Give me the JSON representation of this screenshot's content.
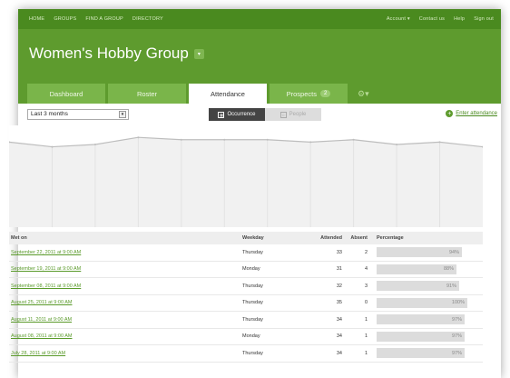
{
  "nav": {
    "left": [
      "HOME",
      "GROUPS",
      "FIND A GROUP",
      "DIRECTORY"
    ],
    "right": [
      "Account ▾",
      "Contact us",
      "Help",
      "Sign out"
    ]
  },
  "group": {
    "title": "Women's Hobby Group"
  },
  "tabs": [
    {
      "label": "Dashboard"
    },
    {
      "label": "Roster"
    },
    {
      "label": "Attendance"
    },
    {
      "label": "Prospects",
      "badge": "2"
    }
  ],
  "controls": {
    "period": "Last 3 months",
    "toggle_occurrence": "Occurrence",
    "toggle_people": "People",
    "enter_attendance": "Enter attendance"
  },
  "chart_data": {
    "type": "area",
    "values": [
      33,
      31,
      32,
      35,
      34,
      34,
      34,
      33,
      34,
      32,
      33,
      31
    ]
  },
  "table": {
    "headers": {
      "met_on": "Met on",
      "weekday": "Weekday",
      "attended": "Attended",
      "absent": "Absent",
      "percentage": "Percentage"
    },
    "rows": [
      {
        "met_on": "September 22, 2011 at 9:00 AM",
        "weekday": "Thursday",
        "attended": "33",
        "absent": "2",
        "percentage": "94%",
        "pct_value": 94
      },
      {
        "met_on": "September 19, 2011 at 9:00 AM",
        "weekday": "Monday",
        "attended": "31",
        "absent": "4",
        "percentage": "88%",
        "pct_value": 88
      },
      {
        "met_on": "September 08, 2011 at 9:00 AM",
        "weekday": "Thursday",
        "attended": "32",
        "absent": "3",
        "percentage": "91%",
        "pct_value": 91
      },
      {
        "met_on": "August 25, 2011 at 9:00 AM",
        "weekday": "Thursday",
        "attended": "35",
        "absent": "0",
        "percentage": "100%",
        "pct_value": 100
      },
      {
        "met_on": "August 11, 2011 at 9:00 AM",
        "weekday": "Thursday",
        "attended": "34",
        "absent": "1",
        "percentage": "97%",
        "pct_value": 97
      },
      {
        "met_on": "August 08, 2011 at 9:00 AM",
        "weekday": "Monday",
        "attended": "34",
        "absent": "1",
        "percentage": "97%",
        "pct_value": 97
      },
      {
        "met_on": "July 28, 2011 at 9:00 AM",
        "weekday": "Thursday",
        "attended": "34",
        "absent": "1",
        "percentage": "97%",
        "pct_value": 97
      }
    ]
  },
  "colors": {
    "brand_green": "#5e9b2e",
    "nav_green": "#4a8a1f",
    "tab_green": "#7ab54a"
  }
}
